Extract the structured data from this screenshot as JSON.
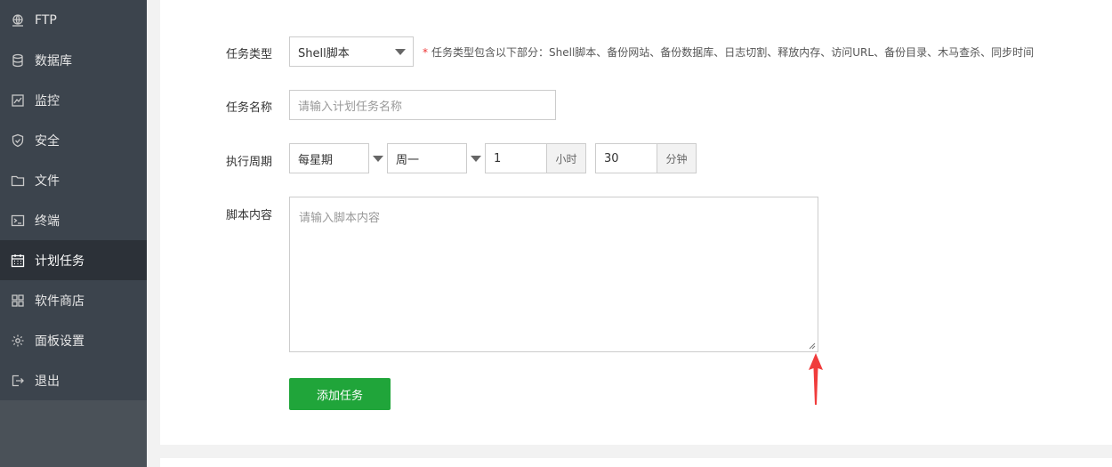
{
  "sidebar": {
    "items": [
      {
        "label": "FTP",
        "icon": "globe-icon",
        "active": false
      },
      {
        "label": "数据库",
        "icon": "database-icon",
        "active": false
      },
      {
        "label": "监控",
        "icon": "monitor-icon",
        "active": false
      },
      {
        "label": "安全",
        "icon": "shield-icon",
        "active": false
      },
      {
        "label": "文件",
        "icon": "folder-icon",
        "active": false
      },
      {
        "label": "终端",
        "icon": "terminal-icon",
        "active": false
      },
      {
        "label": "计划任务",
        "icon": "calendar-icon",
        "active": true
      },
      {
        "label": "软件商店",
        "icon": "grid-icon",
        "active": false
      },
      {
        "label": "面板设置",
        "icon": "gear-icon",
        "active": false
      },
      {
        "label": "退出",
        "icon": "logout-icon",
        "active": false
      }
    ]
  },
  "form": {
    "task_type": {
      "label": "任务类型",
      "value": "Shell脚本",
      "hint": "任务类型包含以下部分：Shell脚本、备份网站、备份数据库、日志切割、释放内存、访问URL、备份目录、木马查杀、同步时间",
      "required_mark": "*"
    },
    "task_name": {
      "label": "任务名称",
      "placeholder": "请输入计划任务名称"
    },
    "period": {
      "label": "执行周期",
      "cycle_value": "每星期",
      "weekday_value": "周一",
      "hour_value": "1",
      "hour_unit": "小时",
      "minute_value": "30",
      "minute_unit": "分钟"
    },
    "script": {
      "label": "脚本内容",
      "placeholder": "请输入脚本内容"
    },
    "submit_label": "添加任务"
  },
  "colors": {
    "sidebar_bg": "#3c444d",
    "sidebar_active": "#2c3138",
    "accent_green": "#20a53a",
    "annotation_red": "#f03c3c"
  }
}
